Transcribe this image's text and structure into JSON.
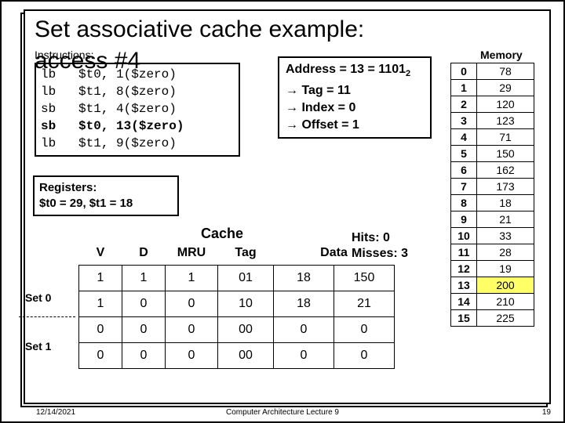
{
  "title_l1": "Set associative cache example:",
  "title_l2": "access #4",
  "instructions_label": "Instructions:",
  "instructions": [
    {
      "op": "lb",
      "reg": "$t0,",
      "addr": "1($zero)",
      "bold": false
    },
    {
      "op": "lb",
      "reg": "$t1,",
      "addr": "8($zero)",
      "bold": false
    },
    {
      "op": "sb",
      "reg": "$t1,",
      "addr": "4($zero)",
      "bold": false
    },
    {
      "op": "sb",
      "reg": "$t0,",
      "addr": "13($zero)",
      "bold": true
    },
    {
      "op": "lb",
      "reg": "$t1,",
      "addr": "9($zero)",
      "bold": false
    }
  ],
  "address_box": {
    "line1_pre": "Address = 13 = 1101",
    "line1_sub": "2",
    "line2": "→ Tag = 11",
    "line3": "→ Index = 0",
    "line4": "→ Offset = 1"
  },
  "registers": {
    "line1": "Registers:",
    "line2": "$t0 = 29, $t1 = 18"
  },
  "cache_label": "Cache",
  "hits": "Hits: 0",
  "misses": "Misses: 3",
  "cache_headers": [
    "V",
    "D",
    "MRU",
    "Tag",
    "Data",
    "Data"
  ],
  "cache_rows": [
    {
      "v": "1",
      "d": "1",
      "mru": "1",
      "tag": "01",
      "d0": "18",
      "d1": "150"
    },
    {
      "v": "1",
      "d": "0",
      "mru": "0",
      "tag": "10",
      "d0": "18",
      "d1": "21"
    },
    {
      "v": "0",
      "d": "0",
      "mru": "0",
      "tag": "00",
      "d0": "0",
      "d1": "0"
    },
    {
      "v": "0",
      "d": "0",
      "mru": "0",
      "tag": "00",
      "d0": "0",
      "d1": "0"
    }
  ],
  "set_labels": [
    "Set 0",
    "Set 1"
  ],
  "memory_label": "Memory",
  "memory": [
    {
      "i": "0",
      "v": "78"
    },
    {
      "i": "1",
      "v": "29"
    },
    {
      "i": "2",
      "v": "120"
    },
    {
      "i": "3",
      "v": "123"
    },
    {
      "i": "4",
      "v": "71"
    },
    {
      "i": "5",
      "v": "150"
    },
    {
      "i": "6",
      "v": "162"
    },
    {
      "i": "7",
      "v": "173"
    },
    {
      "i": "8",
      "v": "18"
    },
    {
      "i": "9",
      "v": "21"
    },
    {
      "i": "10",
      "v": "33"
    },
    {
      "i": "11",
      "v": "28"
    },
    {
      "i": "12",
      "v": "19"
    },
    {
      "i": "13",
      "v": "200",
      "hl": true
    },
    {
      "i": "14",
      "v": "210"
    },
    {
      "i": "15",
      "v": "225"
    }
  ],
  "footer": {
    "date": "12/14/2021",
    "center": "Computer Architecture Lecture 9",
    "page": "19"
  },
  "chart_data": {
    "type": "table",
    "address": 13,
    "address_binary": "1101",
    "tag": "11",
    "index": 0,
    "offset": 1,
    "hits": 0,
    "misses": 3,
    "registers": {
      "$t0": 29,
      "$t1": 18
    },
    "memory": [
      78,
      29,
      120,
      123,
      71,
      150,
      162,
      173,
      18,
      21,
      33,
      28,
      19,
      200,
      210,
      225
    ],
    "cache": {
      "sets": [
        {
          "set": 0,
          "lines": [
            {
              "V": 1,
              "D": 1,
              "MRU": 1,
              "Tag": "01",
              "Data": [
                18,
                150
              ]
            },
            {
              "V": 1,
              "D": 0,
              "MRU": 0,
              "Tag": "10",
              "Data": [
                18,
                21
              ]
            }
          ]
        },
        {
          "set": 1,
          "lines": [
            {
              "V": 0,
              "D": 0,
              "MRU": 0,
              "Tag": "00",
              "Data": [
                0,
                0
              ]
            },
            {
              "V": 0,
              "D": 0,
              "MRU": 0,
              "Tag": "00",
              "Data": [
                0,
                0
              ]
            }
          ]
        }
      ]
    }
  }
}
